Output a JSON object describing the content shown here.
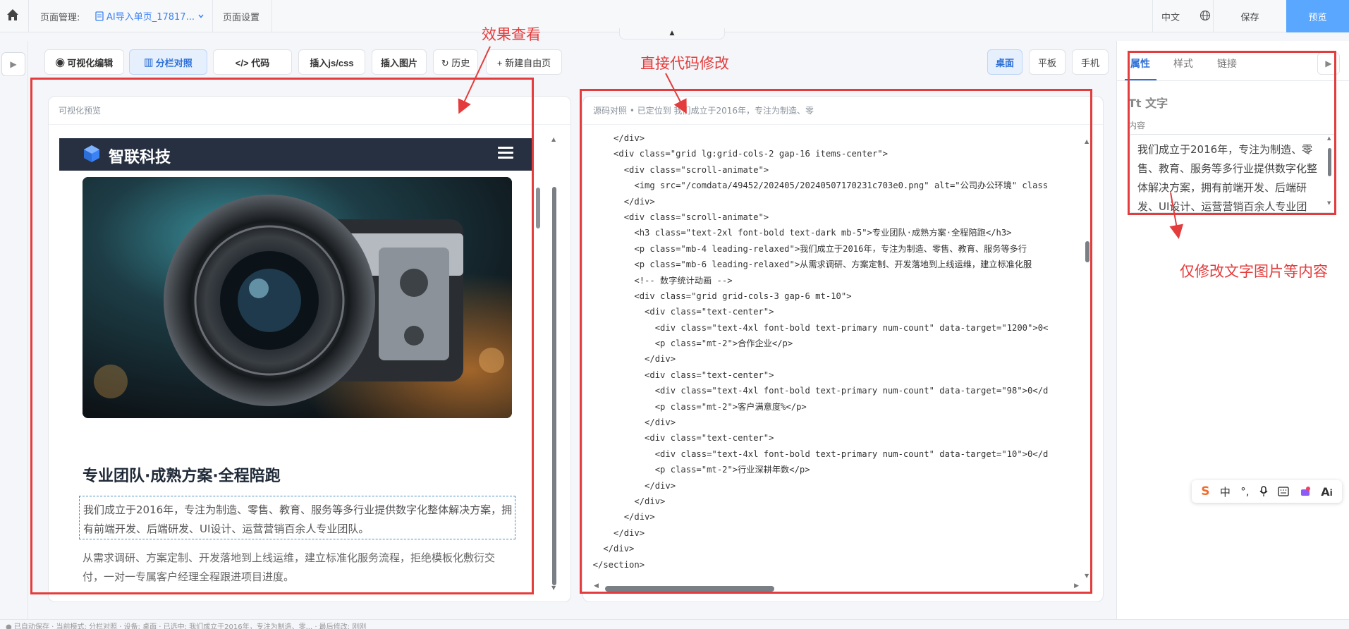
{
  "topbar": {
    "page_manage_label": "页面管理:",
    "current_file": "AI导入单页_17817...",
    "page_settings": "页面设置",
    "language": "中文",
    "save": "保存",
    "preview": "预览"
  },
  "toolbar": {
    "visual_edit": "◉ 可视化编辑",
    "split_view": "▥ 分栏对照",
    "code": "</> 代码",
    "insert_jscss": "插入js/css",
    "insert_image": "插入图片",
    "history": "↻ 历史",
    "new_page": "+ 新建自由页"
  },
  "devices": {
    "desktop": "桌面",
    "tablet": "平板",
    "mobile": "手机"
  },
  "preview_panel": {
    "header": "可视化预览",
    "brand": "智联科技",
    "title": "专业团队·成熟方案·全程陪跑",
    "para1": "我们成立于2016年，专注为制造、零售、教育、服务等多行业提供数字化整体解决方案，拥有前端开发、后端研发、UI设计、运营营销百余人专业团队。",
    "para2": "从需求调研、方案定制、开发落地到上线运维，建立标准化服务流程，拒绝模板化敷衍交付，一对一专属客户经理全程跟进项目进度。"
  },
  "code_panel": {
    "header": "源码对照 • 已定位到 我们成立于2016年，专注为制造、零",
    "lines": [
      "      </div>",
      "      <div class=\"grid lg:grid-cols-2 gap-16 items-center\">",
      "        <div class=\"scroll-animate\">",
      "          <img src=\"/comdata/49452/202405/20240507170231c703e0.png\" alt=\"公司办公环境\" class",
      "        </div>",
      "        <div class=\"scroll-animate\">",
      "          <h3 class=\"text-2xl font-bold text-dark mb-5\">专业团队·成熟方案·全程陪跑</h3>",
      "          <p class=\"mb-4 leading-relaxed\">我们成立于2016年，专注为制造、零售、教育、服务等多行",
      "          <p class=\"mb-6 leading-relaxed\">从需求调研、方案定制、开发落地到上线运维，建立标准化服",
      "          <!-- 数字统计动画 -->",
      "          <div class=\"grid grid-cols-3 gap-6 mt-10\">",
      "            <div class=\"text-center\">",
      "              <div class=\"text-4xl font-bold text-primary num-count\" data-target=\"1200\">0<",
      "              <p class=\"mt-2\">合作企业</p>",
      "            </div>",
      "            <div class=\"text-center\">",
      "              <div class=\"text-4xl font-bold text-primary num-count\" data-target=\"98\">0</d",
      "              <p class=\"mt-2\">客户满意度%</p>",
      "            </div>",
      "            <div class=\"text-center\">",
      "              <div class=\"text-4xl font-bold text-primary num-count\" data-target=\"10\">0</d",
      "              <p class=\"mt-2\">行业深耕年数</p>",
      "            </div>",
      "          </div>",
      "        </div>",
      "      </div>",
      "    </div>",
      "  </section>"
    ]
  },
  "side_panel": {
    "tabs": [
      "属性",
      "样式",
      "链接"
    ],
    "section_title": "Tt 文字",
    "content_label": "内容",
    "content_value": "我们成立于2016年，专注为制造、零售、教育、服务等多行业提供数字化整体解决方案，拥有前端开发、后端研发、UI设计、运营营销百余人专业团队。"
  },
  "annotations": {
    "effect_view": "效果查看",
    "direct_code": "直接代码修改",
    "only_modify": "仅修改文字图片等内容"
  },
  "statusbar": "● 已自动保存 · 当前模式: 分栏对照 · 设备: 桌面 · 已选中: 我们成立于2016年，专注为制造、零... · 最后修改: 刚刚",
  "ime": {
    "mode": "中"
  },
  "colors": {
    "accent": "#2d6fd6",
    "annotation": "#e43c3c",
    "preview_btn": "#5aa7ff"
  }
}
